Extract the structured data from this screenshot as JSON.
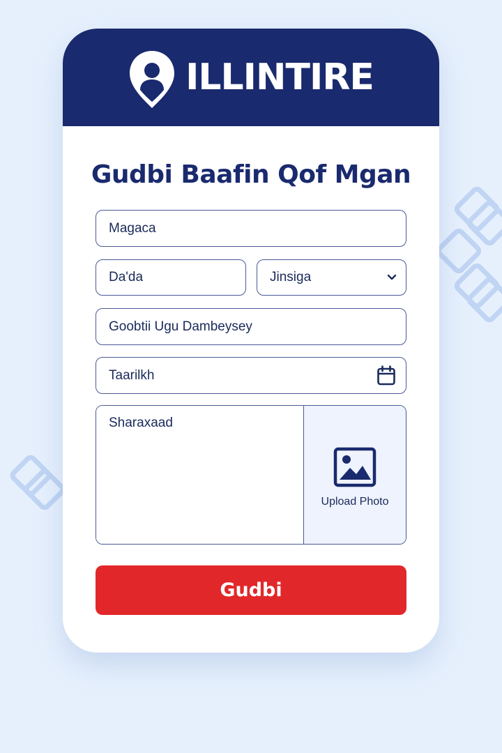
{
  "brand": {
    "name": "ILLINTIRE",
    "logo_icon": "location-pin-person-icon"
  },
  "form": {
    "title": "Gudbi Baafin Qof Mgan",
    "name_placeholder": "Magaca",
    "age_placeholder": "Da'da",
    "gender_select": {
      "selected": "Jinsiga",
      "icon": "chevron-down-icon"
    },
    "last_seen_placeholder": "Goobtii Ugu Dambeysey",
    "date_placeholder": "Taarilkh",
    "date_icon": "calendar-icon",
    "description_placeholder": "Sharaxaad",
    "upload": {
      "label": "Upload Photo",
      "icon": "image-icon"
    },
    "submit_label": "Gudbi"
  },
  "colors": {
    "primary_navy": "#1a2a6e",
    "submit_red": "#e2272a",
    "background": "#e6f0fd",
    "upload_panel": "#eef3fd"
  }
}
